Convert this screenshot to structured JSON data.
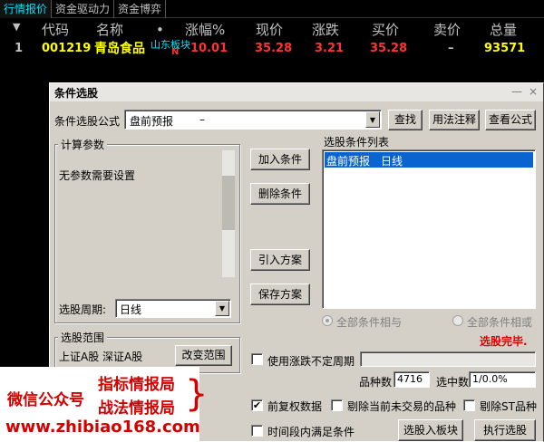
{
  "tabs": [
    "行情报价",
    "资金驱动力",
    "资金博弈"
  ],
  "table": {
    "headers": [
      "代码",
      "名称",
      "•",
      "涨幅%",
      "现价",
      "涨跌",
      "买价",
      "卖价",
      "总量"
    ],
    "row": {
      "index": "1",
      "code": "001219",
      "name": "青岛食品",
      "board_tag": "山东板块",
      "flag": "N",
      "change_pct": "10.01",
      "price": "35.28",
      "change": "3.21",
      "bid": "35.28",
      "ask": "–",
      "volume": "93571"
    }
  },
  "dialog": {
    "title": "条件选股",
    "minimize": "—",
    "close": "×",
    "formula_label": "条件选股公式",
    "formula_value": "盘前预报",
    "formula_dash": "–",
    "find_button": "查找",
    "usage_button": "用法注释",
    "view_formula_button": "查看公式",
    "params_group": "计算参数",
    "no_params_text": "无参数需要设置",
    "add_condition_button": "加入条件",
    "delete_condition_button": "删除条件",
    "import_plan_button": "引入方案",
    "save_plan_button": "保存方案",
    "condition_list_label": "选股条件列表",
    "condition_items": [
      "盘前预报　日线"
    ],
    "period_label": "选股周期:",
    "period_value": "日线",
    "all_and_label": "全部条件相与",
    "all_or_label": "全部条件相或",
    "status_text": "选股完毕.",
    "range_group": "选股范围",
    "range_text": "上证A股  深证A股",
    "change_range_button": "改变范围",
    "uncertain_period_label": "使用涨跌不定周期",
    "stock_count_label": "品种数",
    "stock_count_value": "4716",
    "selected_label": "选中数",
    "selected_value": "1/0.0%",
    "pre_adjust_label": "前复权数据",
    "pre_adjust_checked": true,
    "exclude_untraded_label": "剔除当前未交易的品种",
    "exclude_st_label": "剔除ST品种",
    "time_range_label": "时间段内满足条件",
    "select_to_board_button": "选股入板块",
    "run_button": "执行选股"
  },
  "watermark": {
    "wechat": "微信公众号",
    "line1": "指标情报局",
    "line2": "战法情报局",
    "url": "www.zhibiao168.com"
  },
  "colors": {
    "code": "#ffff00",
    "name": "#ffff00",
    "board_tag": "#00e5ff",
    "up": "#ff3232",
    "selected_item_bg": "#0a64d0",
    "status_text": "#e00000"
  }
}
